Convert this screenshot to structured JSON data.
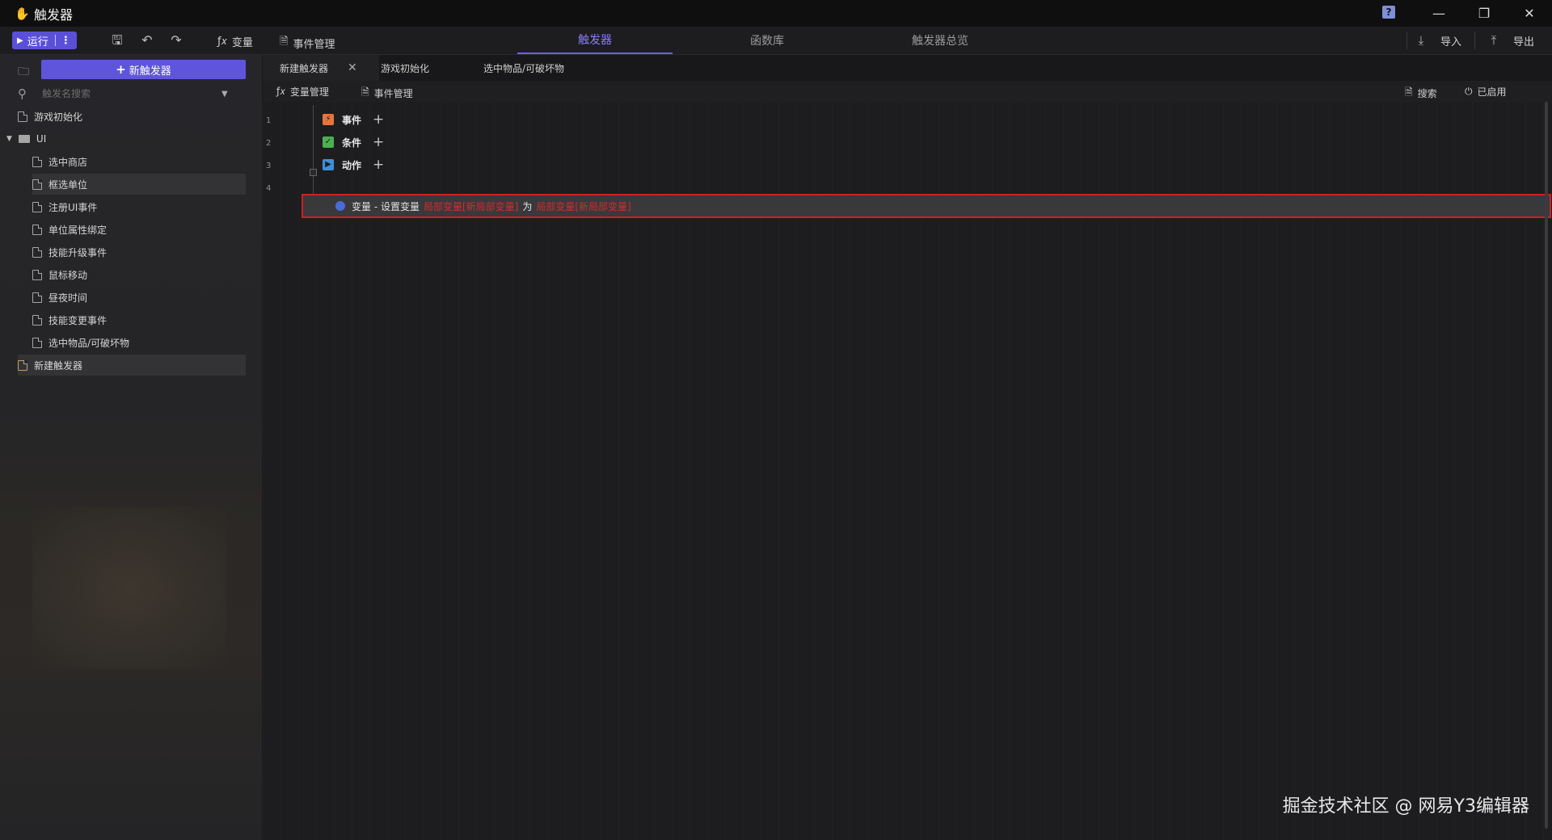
{
  "window": {
    "title": "触发器",
    "controls": {
      "help": "?",
      "minimize": "—",
      "restore": "❐",
      "close": "✕"
    }
  },
  "toolbar": {
    "run_label": "运行",
    "variables_label": "变量",
    "event_mgmt_label": "事件管理",
    "tabs": [
      "触发器",
      "函数库",
      "触发器总览"
    ],
    "active_tab": "触发器",
    "import_label": "导入",
    "export_label": "导出"
  },
  "sidebar": {
    "new_trigger_label": "新触发器",
    "search_placeholder": "触发名搜索",
    "items": [
      {
        "label": "游戏初始化"
      },
      {
        "label": "UI"
      },
      {
        "label": "选中商店"
      },
      {
        "label": "框选单位"
      },
      {
        "label": "注册UI事件"
      },
      {
        "label": "单位属性绑定"
      },
      {
        "label": "技能升级事件"
      },
      {
        "label": "鼠标移动"
      },
      {
        "label": "昼夜时间"
      },
      {
        "label": "技能变更事件"
      },
      {
        "label": "选中物品/可破坏物"
      },
      {
        "label": "新建触发器"
      }
    ]
  },
  "editor": {
    "doc_tabs": [
      "新建触发器",
      "游戏初始化",
      "选中物品/可破坏物"
    ],
    "active_doc_tab": "新建触发器",
    "subtoolbar": {
      "var_mgmt": "变量管理",
      "event_mgmt": "事件管理",
      "search": "搜索",
      "enabled": "已启用"
    },
    "lines": [
      {
        "num": "1",
        "label": "事件"
      },
      {
        "num": "2",
        "label": "条件"
      },
      {
        "num": "3",
        "label": "动作"
      },
      {
        "num": "4"
      }
    ],
    "action": {
      "prefix": "变量 - 设置变量",
      "param1": "局部变量[新局部变量]",
      "middle": "为",
      "param2": "局部变量[新局部变量]"
    }
  },
  "watermark": "掘金技术社区 @ 网易Y3编辑器",
  "colors": {
    "accent": "#5f55dc",
    "active_tab": "#8a7cff",
    "highlight_border": "#d0201f",
    "event_icon": "#e8743b",
    "condition_icon": "#4caf50",
    "action_icon": "#3f8fd8"
  }
}
